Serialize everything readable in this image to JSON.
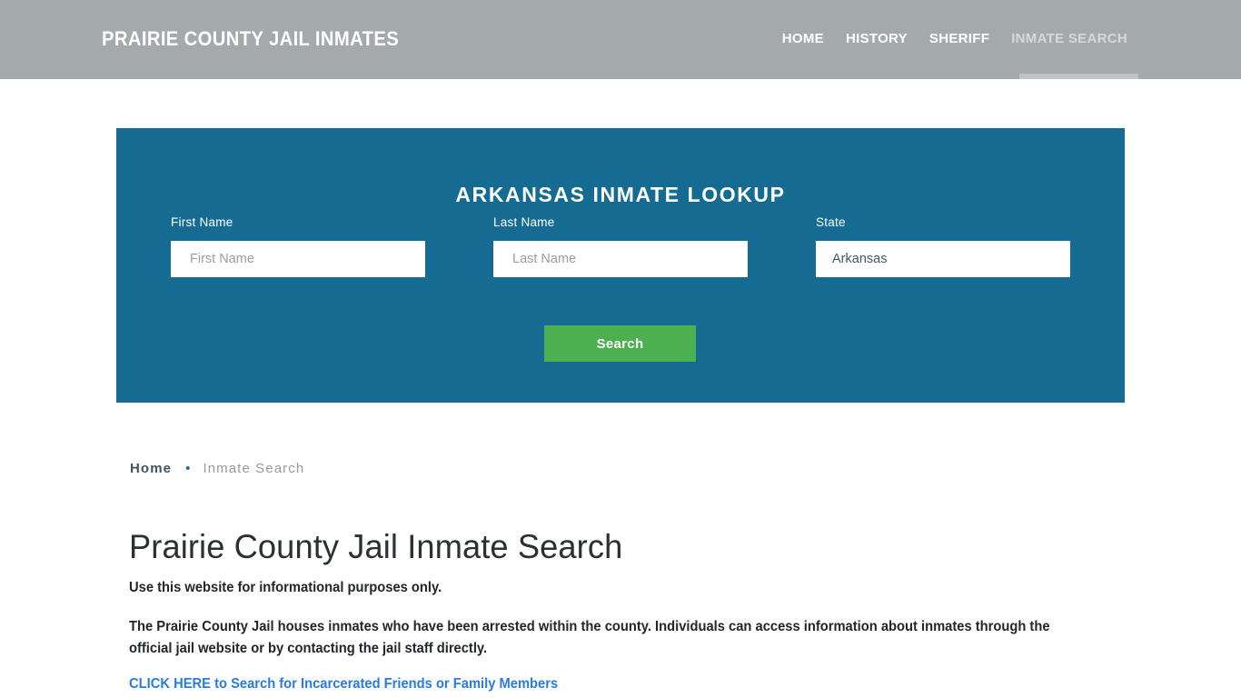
{
  "header": {
    "brand": "PRAIRIE COUNTY JAIL INMATES",
    "background_color": "#a4a9ac",
    "nav": [
      {
        "label": "HOME",
        "active": false
      },
      {
        "label": "HISTORY",
        "active": false
      },
      {
        "label": "SHERIFF",
        "active": false
      },
      {
        "label": "INMATE SEARCH",
        "active": true
      }
    ]
  },
  "lookup": {
    "title": "ARKANSAS INMATE LOOKUP",
    "panel_color": "#166b92",
    "fields": {
      "first_name": {
        "label": "First Name",
        "placeholder": "First Name",
        "value": ""
      },
      "last_name": {
        "label": "Last Name",
        "placeholder": "Last Name",
        "value": ""
      },
      "state": {
        "label": "State",
        "value": "Arkansas",
        "options": [
          "Arkansas"
        ]
      }
    },
    "search_button": {
      "label": "Search",
      "color": "#4caf50"
    }
  },
  "breadcrumb": {
    "home_label": "Home",
    "separator": "•",
    "current_label": "Inmate Search"
  },
  "content": {
    "title": "Prairie County Jail Inmate Search",
    "lede": "Use this website for informational purposes only.",
    "paragraph": "The Prairie County Jail houses inmates who have been arrested within the county. Individuals can access information about inmates through the official jail website or by contacting the jail staff directly.",
    "cta_link": {
      "label": "CLICK HERE to Search for Incarcerated Friends or Family Members",
      "color": "#2a7ae2"
    }
  }
}
